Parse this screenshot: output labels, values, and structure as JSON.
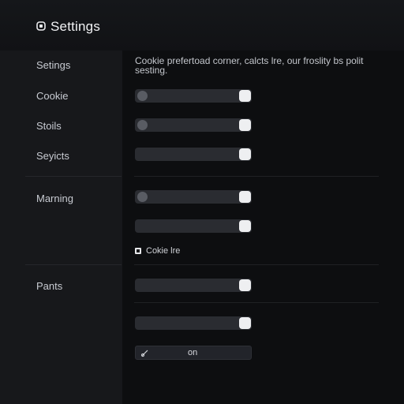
{
  "header": {
    "title": "Settings",
    "icon": "gear-icon"
  },
  "sidebar": {
    "items": [
      {
        "label": "Setings"
      },
      {
        "label": "Cookie"
      },
      {
        "label": "Stoils"
      },
      {
        "label": "Seyicts"
      },
      {
        "label": "Marning"
      },
      {
        "label": "Pants"
      }
    ]
  },
  "content": {
    "description": "Cookie prefertoad corner, calcts lre, our froslity bs polit sesting.",
    "toggles": [
      {
        "state": "on"
      },
      {
        "state": "on"
      },
      {
        "state": "on"
      },
      {
        "state": "on"
      },
      {
        "state": "on"
      },
      {
        "state": "on"
      },
      {
        "state": "on"
      }
    ],
    "checkbox": {
      "label": "Cokie lre",
      "checked": true
    },
    "input": {
      "value": "on",
      "icon": "pencil-icon"
    }
  },
  "colors": {
    "background": "#0d0e10",
    "sidebar": "#17181b",
    "track": "#2a2c31",
    "knob": "#eeeff1"
  }
}
